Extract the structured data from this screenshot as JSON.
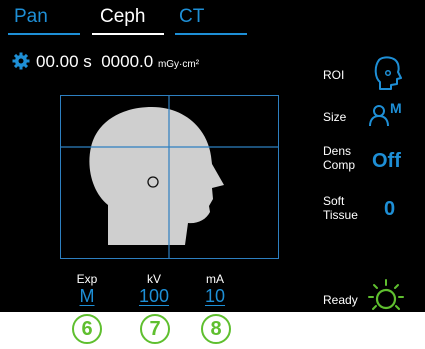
{
  "tabs": [
    {
      "label": "Pan",
      "active": false
    },
    {
      "label": "Ceph",
      "active": true
    },
    {
      "label": "CT",
      "active": false
    }
  ],
  "status": {
    "time": "00.00 s",
    "dose": "0000.0",
    "dose_unit": "mGy·cm²"
  },
  "side_panel": {
    "roi_label": "ROI",
    "size_label": "Size",
    "size_value": "M",
    "dens_comp_label_line1": "Dens",
    "dens_comp_label_line2": "Comp",
    "dens_comp_value": "Off",
    "soft_tissue_label_line1": "Soft",
    "soft_tissue_label_line2": "Tissue",
    "soft_tissue_value": "0",
    "ready_label": "Ready"
  },
  "parameters": {
    "exp_label": "Exp",
    "exp_value": "M",
    "kv_label": "kV",
    "kv_value": "100",
    "ma_label": "mA",
    "ma_value": "10"
  },
  "callouts": [
    "6",
    "7",
    "8"
  ],
  "colors": {
    "background": "#000000",
    "accent_blue": "#1e8fd6",
    "callout_green": "#5fbf2f",
    "head_fill": "#cfcfcf",
    "frame_blue": "#2d7fc0"
  },
  "icons": {
    "gear": "gear-icon",
    "roi": "head-roi-icon",
    "size": "patient-size-icon",
    "ready": "ready-indicator-icon"
  }
}
